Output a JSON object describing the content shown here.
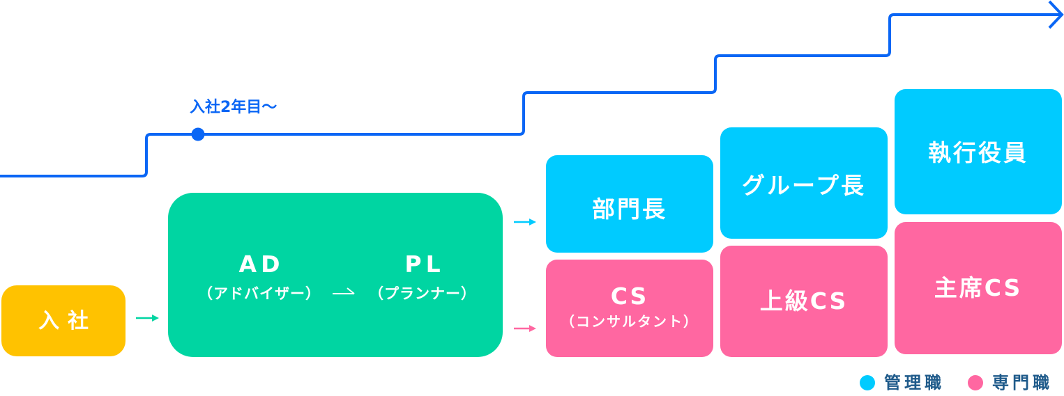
{
  "timeline": {
    "milestone_label": "入社2年目〜"
  },
  "stages": {
    "entry": {
      "label": "入社"
    },
    "junior": {
      "ad": {
        "code": "AD",
        "name": "（アドバイザー）"
      },
      "pl": {
        "code": "PL",
        "name": "（プランナー）"
      }
    },
    "management": [
      {
        "label": "部門長"
      },
      {
        "label": "グループ長"
      },
      {
        "label": "執行役員"
      }
    ],
    "specialist": [
      {
        "label": "CS",
        "sub": "（コンサルタント）"
      },
      {
        "label": "上級CS"
      },
      {
        "label": "主席CS"
      }
    ]
  },
  "legend": [
    {
      "label": "管理職",
      "color": "#00CBFF"
    },
    {
      "label": "専門職",
      "color": "#FF67A1"
    }
  ],
  "colors": {
    "management": "#00CBFF",
    "specialist": "#FF67A1",
    "junior": "#00D5A2",
    "entry": "#FFC200",
    "career_line": "#0A66F5",
    "legend_text": "#1E5A8A"
  }
}
